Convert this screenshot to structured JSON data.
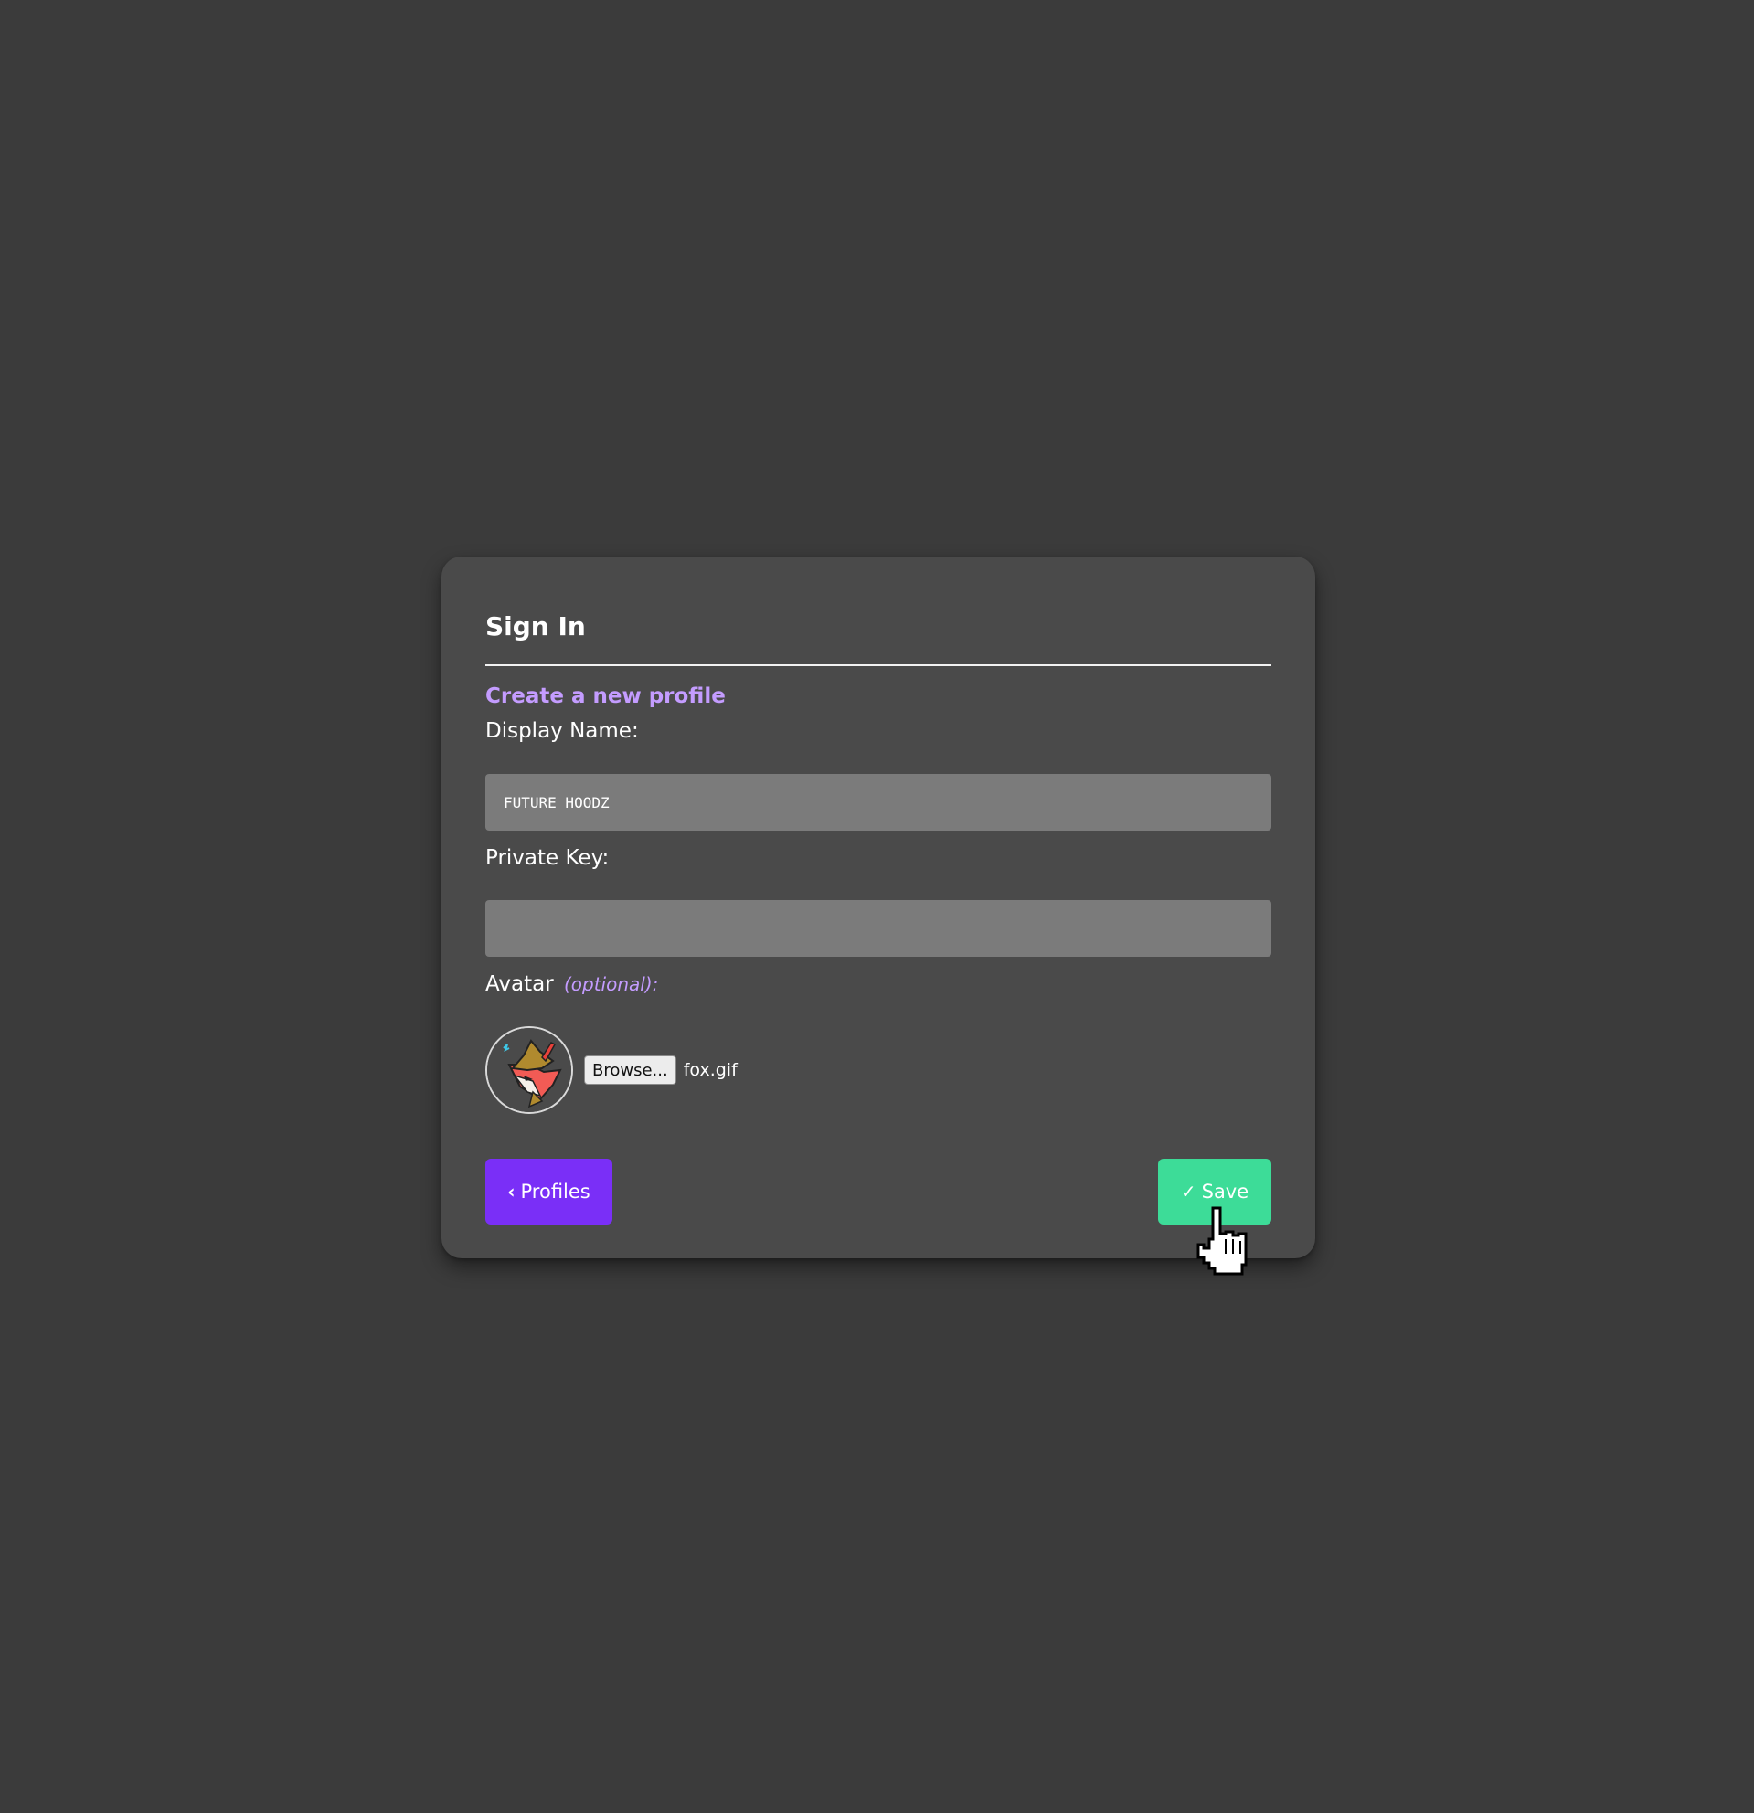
{
  "card": {
    "title": "Sign In",
    "subtitle": "Create a new profile"
  },
  "form": {
    "display_name_label": "Display Name:",
    "display_name_value": "FUTURE HOODZ",
    "private_key_label": "Private Key:",
    "private_key_value": "",
    "avatar_label": "Avatar",
    "avatar_optional": "(optional):",
    "browse_label": "Browse...",
    "file_name": "fox.gif"
  },
  "buttons": {
    "profiles_icon": "‹",
    "profiles_label": "Profiles",
    "save_icon": "✓",
    "save_label": "Save"
  },
  "colors": {
    "background": "#3b3b3b",
    "card": "#4a4a4a",
    "accent_purple": "#7a2ff7",
    "accent_lavender": "#c49cff",
    "accent_green": "#3ddc98",
    "field": "#7b7b7b"
  },
  "icons": {
    "avatar": "fox-avatar",
    "cursor": "hand-pointer-cursor"
  }
}
